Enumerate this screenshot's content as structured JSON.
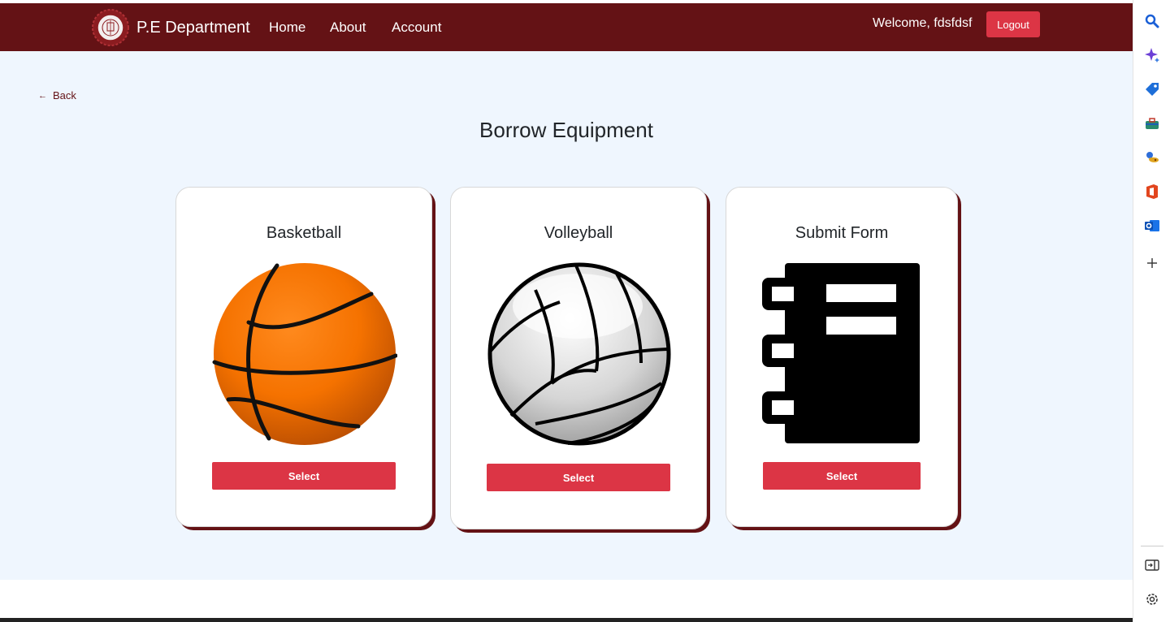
{
  "navbar": {
    "brand": "P.E Department",
    "links": [
      "Home",
      "About",
      "Account"
    ],
    "welcome": "Welcome, fdsfdsf",
    "logout_label": "Logout"
  },
  "back_label": "Back",
  "page_title": "Borrow Equipment",
  "cards": [
    {
      "title": "Basketball",
      "button_label": "Select",
      "image": "basketball-image"
    },
    {
      "title": "Volleyball",
      "button_label": "Select",
      "image": "volleyball-image"
    },
    {
      "title": "Submit Form",
      "button_label": "Select",
      "image": "notebook-image"
    }
  ],
  "sidebar_icons": [
    "search-icon",
    "copilot-icon",
    "shopping-tag-icon",
    "toolbox-icon",
    "games-icon",
    "office-icon",
    "outlook-icon",
    "add-icon",
    "split-screen-icon",
    "settings-icon"
  ],
  "colors": {
    "navbar": "#641215",
    "button": "#dc3545",
    "background": "#eff6fe"
  }
}
